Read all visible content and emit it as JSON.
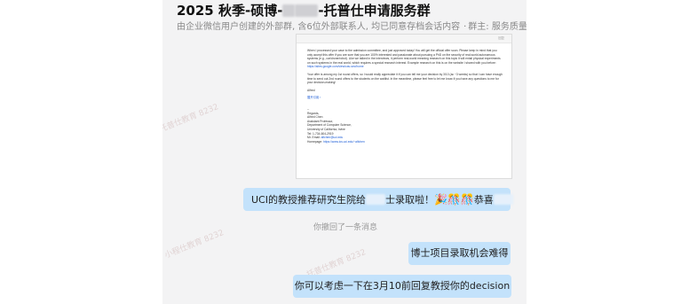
{
  "group": {
    "title_prefix": "2025 秋季-硕博-",
    "title_suffix": "-托普仕申请服务群",
    "subtitle": "由企业微信用户创建的外部群, 含6位外部联系人, 均已同意存档会话内容",
    "tag": "群主: 服务质量监督"
  },
  "email": {
    "header_link": "回复",
    "para1": "When I processed your case to the admission committee, and just approved today! You will get the official offer soon. Please keep in mind that you only accept this offer if you are sure that you are 100% interested and passionate about pursuing a PhD on the security of real-world autonomous systems (e.g., car/drone/robot). Like we talked in the interviews, it perform real-world meaning research on this topic it will entail physical experiments on such systems in the real world, which requires a special research interest. Example research on this is on the website I shared with you before:",
    "para1_link": "https://sites.google.com/view/cav-sec/home",
    "para2": "Your offer is among my 1st round offers, so I would really appreciate it if you can tell me your decision by 3/10 (ac ~3 weeks) so that I can have enough time to send out 2nd round offers to the students on the waitlist. In the meantime, please feel free to let me know if you have any questions to me for your decision-making!",
    "closing": "Alfred",
    "fold_text": "展开引用 ›",
    "sig_dashes": "--",
    "sig_regards": "Regards,",
    "sig_name": "Alfred Chen",
    "sig_title": "Assistant Professor,",
    "sig_dept": "Department of Computer Science,",
    "sig_univ": "University of California, Irvine",
    "sig_tel": "Tel: 1-734-604-2919",
    "sig_email_label": "Mr. Email: ",
    "sig_email": "alfchen@uci.edu",
    "sig_web_label": "Homepage: ",
    "sig_web": "https://www.ics.uci.edu/~alfchen"
  },
  "messages": [
    {
      "text_a": "UCI的教授推荐研究生院给",
      "text_b": "士录取啦！",
      "emoji": "🎉🎊🎊",
      "text_c": "恭喜"
    },
    {
      "text": "你撤回了一条消息"
    },
    {
      "text": "博士项目录取机会难得"
    },
    {
      "text": "你可以考虑一下在3月10前回复教授你的decision"
    }
  ],
  "watermarks": {
    "a": "托普仕教育 8232",
    "b": "小程仕教育 8232",
    "c": "托普仕教育 8232"
  }
}
